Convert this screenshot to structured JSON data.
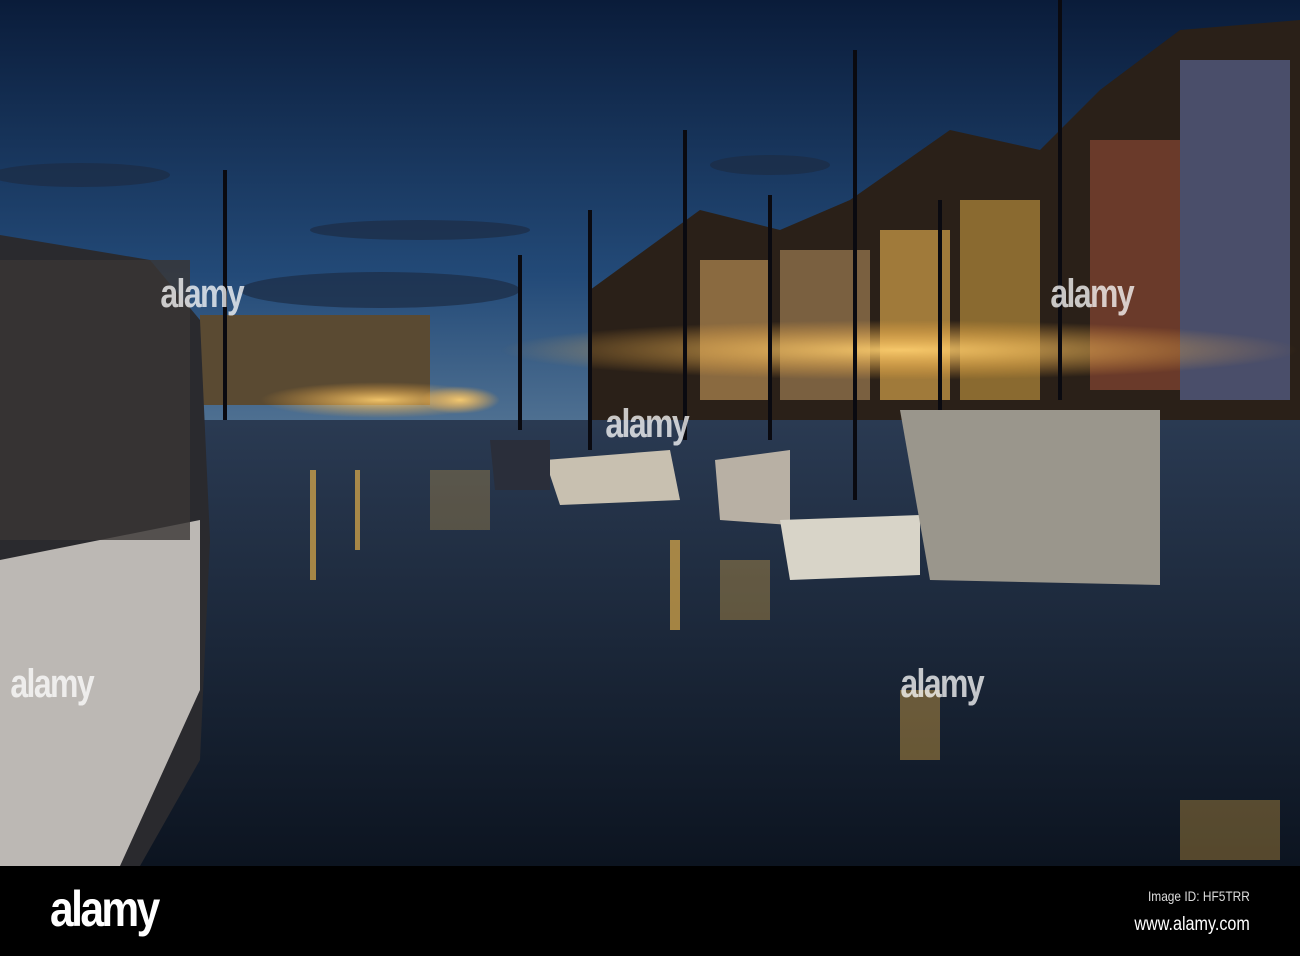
{
  "photo": {
    "subject": "Nyhavn canal at dusk with moored boats and Christmas lights",
    "colors": {
      "sky_top": "#0d2344",
      "sky_horizon": "#4a6a8c",
      "water": "#1a2a3e",
      "lights": "#ffc24a"
    }
  },
  "watermark": {
    "text": "alamy"
  },
  "footer": {
    "logo": "alamy",
    "image_id": "Image ID: HF5TRR",
    "website": "www.alamy.com"
  }
}
